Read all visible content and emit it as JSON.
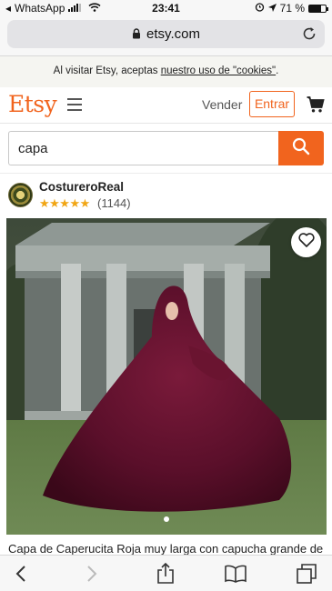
{
  "status_bar": {
    "carrier": "WhatsApp",
    "time": "23:41",
    "battery_text": "71 %",
    "battery_level": 0.71
  },
  "browser": {
    "url": "etsy.com"
  },
  "cookie_banner": {
    "text_before": "Al visitar Etsy, aceptas ",
    "link_text": "nuestro uso de \"cookies\"",
    "text_after": "."
  },
  "header": {
    "logo": "Etsy",
    "sell_label": "Vender",
    "signin_label": "Entrar"
  },
  "search": {
    "value": "capa"
  },
  "shop": {
    "name": "CostureroReal",
    "stars": "★★★★★",
    "rating": 5,
    "review_count": "(1144)"
  },
  "listing": {
    "title": "Capa de Caperucita Roja muy larga con capucha grande de"
  },
  "colors": {
    "brand_orange": "#f1641e",
    "star_color": "#f1a614"
  },
  "icons": [
    "whatsapp-back",
    "wifi-icon",
    "lock-icon",
    "reload-icon",
    "hamburger-icon",
    "cart-icon",
    "search-icon",
    "heart-icon",
    "back-icon",
    "forward-icon",
    "share-icon",
    "bookmarks-icon",
    "tabs-icon"
  ]
}
